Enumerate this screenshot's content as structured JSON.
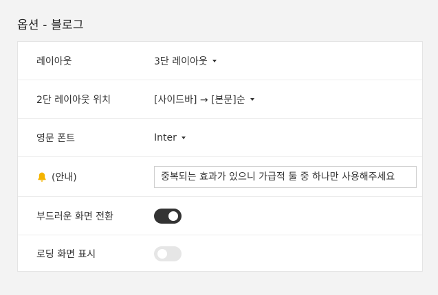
{
  "page": {
    "title": "옵션 - 블로그"
  },
  "options": {
    "layout": {
      "label": "레이아웃",
      "value": "3단 레이아웃"
    },
    "two_column_position": {
      "label": "2단 레이아웃 위치",
      "value": "[사이드바] → [본문]순"
    },
    "english_font": {
      "label": "영문 폰트",
      "value": "Inter"
    },
    "notice": {
      "icon": "bell-icon",
      "label": "(안내)",
      "text": "중복되는 효과가 있으니 가급적 둘 중 하나만 사용해주세요"
    },
    "smooth_transition": {
      "label": "부드러운 화면 전환",
      "enabled": true
    },
    "loading_screen": {
      "label": "로딩 화면 표시",
      "enabled": false
    }
  },
  "colors": {
    "toggle_on": "#333333",
    "toggle_off": "#e6e6e6",
    "bell": "#f5b400"
  }
}
